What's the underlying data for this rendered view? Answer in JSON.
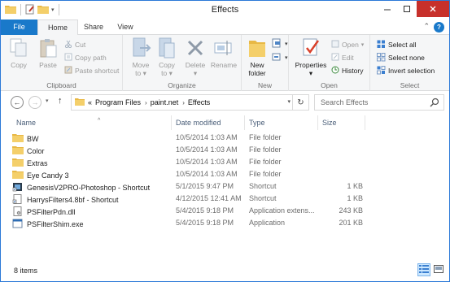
{
  "window": {
    "title": "Effects"
  },
  "tabs": {
    "file": "File",
    "home": "Home",
    "share": "Share",
    "view": "View"
  },
  "ribbon": {
    "clipboard": {
      "label": "Clipboard",
      "copy": "Copy",
      "paste": "Paste",
      "cut": "Cut",
      "copy_path": "Copy path",
      "paste_shortcut": "Paste shortcut"
    },
    "organize": {
      "label": "Organize",
      "move_to_1": "Move",
      "move_to_2": "to",
      "copy_to_1": "Copy",
      "copy_to_2": "to",
      "delete": "Delete",
      "rename": "Rename"
    },
    "new": {
      "label": "New",
      "new_folder_1": "New",
      "new_folder_2": "folder"
    },
    "open": {
      "label": "Open",
      "properties": "Properties",
      "open": "Open",
      "edit": "Edit",
      "history": "History"
    },
    "select": {
      "label": "Select",
      "select_all": "Select all",
      "select_none": "Select none",
      "invert_selection": "Invert selection"
    }
  },
  "address": {
    "overflow": "«",
    "crumbs": [
      "Program Files",
      "paint.net",
      "Effects"
    ],
    "search_placeholder": "Search Effects"
  },
  "columns": {
    "name": "Name",
    "date_modified": "Date modified",
    "type": "Type",
    "size": "Size"
  },
  "files": [
    {
      "icon": "folder-icon",
      "name": "BW",
      "date": "10/5/2014 1:03 AM",
      "type": "File folder",
      "size": ""
    },
    {
      "icon": "folder-icon",
      "name": "Color",
      "date": "10/5/2014 1:03 AM",
      "type": "File folder",
      "size": ""
    },
    {
      "icon": "folder-icon",
      "name": "Extras",
      "date": "10/5/2014 1:03 AM",
      "type": "File folder",
      "size": ""
    },
    {
      "icon": "folder-icon",
      "name": "Eye Candy 3",
      "date": "10/5/2014 1:03 AM",
      "type": "File folder",
      "size": ""
    },
    {
      "icon": "shortcut-icon",
      "name": "GenesisV2PRO-Photoshop - Shortcut",
      "date": "5/1/2015 9:47 PM",
      "type": "Shortcut",
      "size": "1 KB"
    },
    {
      "icon": "shortcut-file-icon",
      "name": "HarrysFilters4.8bf - Shortcut",
      "date": "4/12/2015 12:41 AM",
      "type": "Shortcut",
      "size": "1 KB"
    },
    {
      "icon": "dll-icon",
      "name": "PSFilterPdn.dll",
      "date": "5/4/2015 9:18 PM",
      "type": "Application extens...",
      "size": "243 KB"
    },
    {
      "icon": "exe-icon",
      "name": "PSFilterShim.exe",
      "date": "5/4/2015 9:18 PM",
      "type": "Application",
      "size": "201 KB"
    }
  ],
  "status": {
    "item_count": "8 items"
  },
  "colors": {
    "accent": "#1979ca",
    "folder": "#e8b845",
    "close": "#c7302b"
  }
}
